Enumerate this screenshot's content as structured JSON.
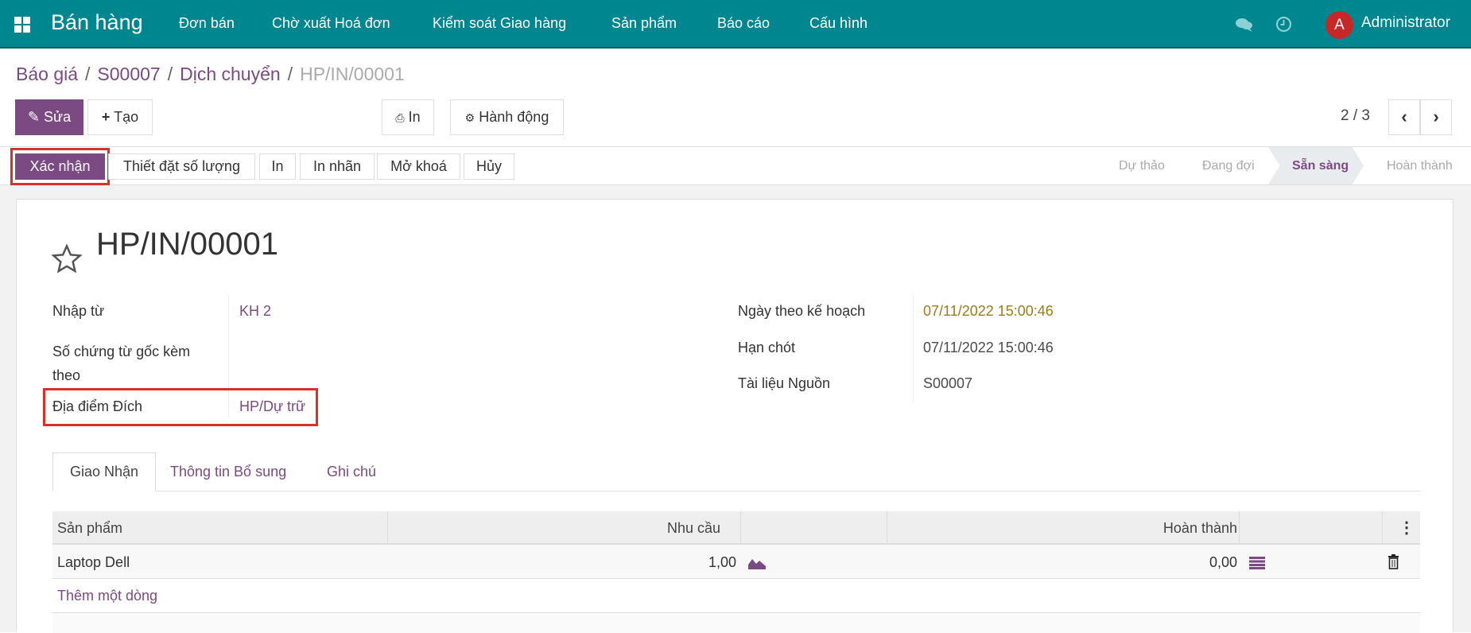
{
  "navbar": {
    "app_title": "Bán hàng",
    "menu": [
      "Đơn bán",
      "Chờ xuất Hoá đơn",
      "Kiểm soát Giao hàng",
      "Sản phẩm",
      "Báo cáo",
      "Cấu hình"
    ],
    "avatar_letter": "A",
    "user": "Administrator",
    "icons": [
      "apps-grid-icon",
      "chat-icon",
      "clock-icon"
    ]
  },
  "breadcrumb": {
    "items": [
      "Báo giá",
      "S00007",
      "Dịch chuyển"
    ],
    "current": "HP/IN/00001"
  },
  "toolbar": {
    "edit": "Sửa",
    "create": "Tạo",
    "print": "In",
    "action": "Hành động",
    "pager": "2 / 3"
  },
  "statusbar": {
    "buttons": [
      "Xác nhận",
      "Thiết đặt số lượng",
      "In",
      "In nhãn",
      "Mở khoá",
      "Hủy"
    ],
    "stages": [
      "Dự thảo",
      "Đang đợi",
      "Sẵn sàng",
      "Hoàn thành"
    ],
    "active_stage": "Sẵn sàng"
  },
  "record": {
    "title": "HP/IN/00001",
    "left": [
      {
        "label": "Nhập từ",
        "value": "KH 2"
      },
      {
        "label": "Số chứng từ gốc kèm theo",
        "value": ""
      },
      {
        "label": "Địa điểm Đích",
        "value": "HP/Dự trữ"
      }
    ],
    "right": [
      {
        "label": "Ngày theo kế hoạch",
        "value": "07/11/2022 15:00:46"
      },
      {
        "label": "Hạn chót",
        "value": "07/11/2022 15:00:46"
      },
      {
        "label": "Tài liệu Nguồn",
        "value": "S00007"
      }
    ]
  },
  "tabs": [
    "Giao Nhận",
    "Thông tin Bổ sung",
    "Ghi chú"
  ],
  "table": {
    "headers": [
      "Sản phẩm",
      "Nhu cầu",
      "Hoàn thành"
    ],
    "rows": [
      {
        "product": "Laptop Dell",
        "demand": "1,00",
        "done": "0,00"
      }
    ],
    "add_line": "Thêm một dòng"
  },
  "colors": {
    "navbar": "#00868f",
    "primary": "#7c4a83",
    "highlight": "#d9302c",
    "date_warning": "#a07b1a"
  }
}
